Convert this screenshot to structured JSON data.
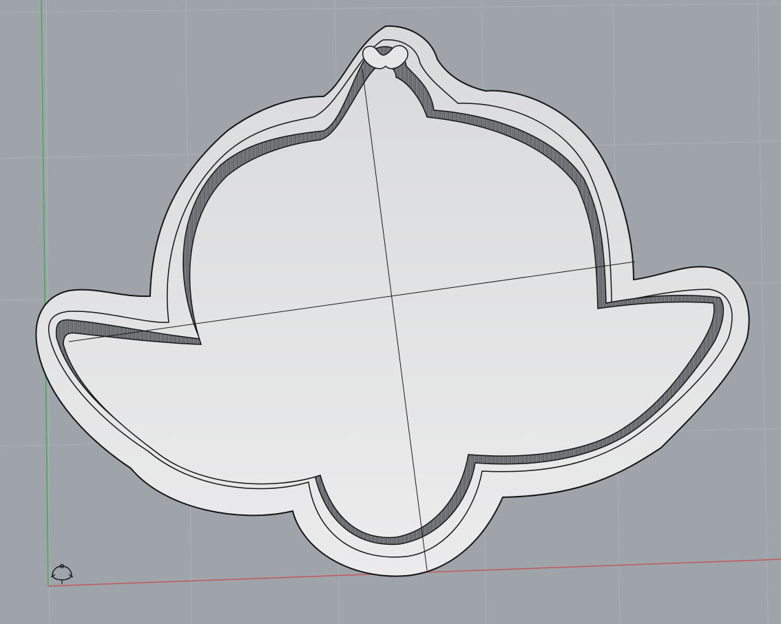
{
  "viewport": {
    "type": "perspective-3d",
    "background_color": "#9fa4ab",
    "grid_color": "#aab0b7",
    "x_axis_color": "#c05a5a",
    "y_axis_color": "#3fae4a",
    "grid_visible": true
  },
  "model": {
    "shape": "cookie-cutter-cloud-with-wings",
    "fill_color": "#e2e3e4",
    "wall_shade_color": "#6d6f73",
    "outline_color": "#151515"
  },
  "world_axes_icon": "world-axes-icon"
}
